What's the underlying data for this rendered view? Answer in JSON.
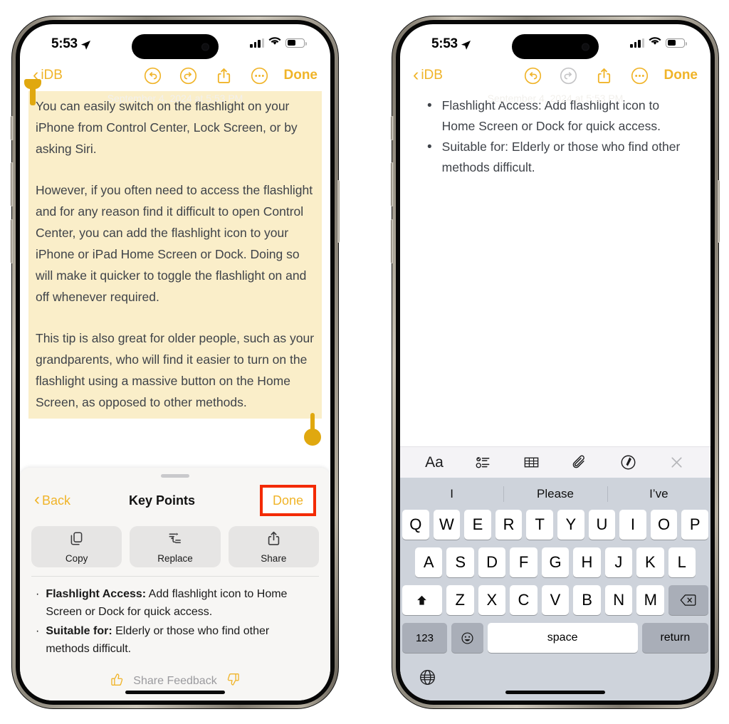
{
  "status_bar": {
    "time": "5:53",
    "location_icon": "location-arrow-icon",
    "cellular_icon": "cellular-signal-icon",
    "wifi_icon": "wifi-icon",
    "battery_icon": "battery-icon",
    "battery_level_percent": 44
  },
  "colors": {
    "accent_yellow": "#f0b429",
    "highlight_yellow": "#faeec9",
    "selection_handle": "#e0a80f",
    "annotation_red": "#f32a00",
    "keyboard_bg": "#ced3db",
    "key_bg": "#ffffff",
    "key_modifier_bg": "#a9aeb8",
    "sheet_bg": "#f7f6f4",
    "note_text": "#3f4349"
  },
  "phone_left": {
    "toolbar": {
      "back_label": "iDB",
      "undo_icon": "undo-icon",
      "redo_icon": "redo-icon",
      "share_icon": "share-icon",
      "more_icon": "ellipsis-circle-icon",
      "done_label": "Done",
      "undo_enabled": true,
      "redo_enabled": true
    },
    "date_stamp": "September 4, 2024 at 5:53 PM",
    "note_paragraphs": [
      "You can easily switch on the flashlight on your iPhone from Control Center, Lock Screen, or by asking Siri.",
      "However, if you often need to access the flashlight and for any reason find it difficult to open Control Center, you can add the flashlight icon to your iPhone or iPad Home Screen or Dock. Doing so will make it quicker to toggle the flashlight on and off whenever required.",
      "This tip is also great for older people, such as your grandparents, who will find it easier to turn on the flashlight using a massive button on the Home Screen, as opposed to other methods."
    ],
    "key_points_sheet": {
      "back_label": "Back",
      "title": "Key Points",
      "done_label": "Done",
      "actions": [
        {
          "label": "Copy",
          "icon": "copy-icon"
        },
        {
          "label": "Replace",
          "icon": "replace-icon"
        },
        {
          "label": "Share",
          "icon": "share-icon"
        }
      ],
      "items": [
        {
          "bullet": "·",
          "bold": "Flashlight Access:",
          "text": " Add flashlight icon to Home Screen or Dock for quick access."
        },
        {
          "bullet": "·",
          "bold": "Suitable for:",
          "text": " Elderly or those who find other methods difficult."
        }
      ],
      "feedback": {
        "label": "Share Feedback",
        "thumbs_up_icon": "thumbs-up-icon",
        "thumbs_down_icon": "thumbs-down-icon"
      }
    }
  },
  "phone_right": {
    "toolbar": {
      "back_label": "iDB",
      "undo_icon": "undo-icon",
      "redo_icon": "redo-icon",
      "share_icon": "share-icon",
      "more_icon": "ellipsis-circle-icon",
      "done_label": "Done",
      "undo_enabled": true,
      "redo_enabled": false
    },
    "date_stamp": "September 4, 2024 at 5:53 PM",
    "note_items": [
      "Flashlight Access: Add flashlight icon to Home Screen or Dock for quick access.",
      "Suitable for: Elderly or those who find other methods difficult."
    ],
    "keyboard": {
      "toolbar_icons": [
        "format-aa-icon",
        "checklist-icon",
        "table-icon",
        "attachment-paperclip-icon",
        "markup-pen-icon",
        "close-x-icon"
      ],
      "format_label": "Aa",
      "predictions": [
        "I",
        "Please",
        "I’ve"
      ],
      "row1": [
        "Q",
        "W",
        "E",
        "R",
        "T",
        "Y",
        "U",
        "I",
        "O",
        "P"
      ],
      "row2": [
        "A",
        "S",
        "D",
        "F",
        "G",
        "H",
        "J",
        "K",
        "L"
      ],
      "row3": [
        "Z",
        "X",
        "C",
        "V",
        "B",
        "N",
        "M"
      ],
      "shift_icon": "shift-arrow-icon",
      "delete_icon": "delete-backward-icon",
      "numbers_label": "123",
      "emoji_icon": "emoji-smiley-icon",
      "space_label": "space",
      "return_label": "return",
      "globe_icon": "globe-icon"
    }
  }
}
